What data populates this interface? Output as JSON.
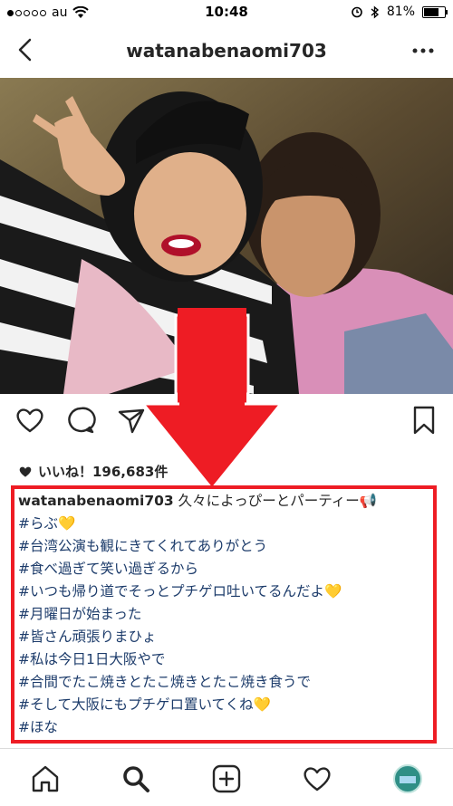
{
  "status_bar": {
    "carrier": "au",
    "time": "10:48",
    "battery": "81%",
    "battery_level": 0.81
  },
  "header": {
    "title": "watanabenaomi703"
  },
  "post": {
    "likes_label": "いいね！196,683件",
    "caption_user": "watanabenaomi703",
    "caption_first": "久々によっぴーとパーティー📢",
    "caption_lines": [
      "#らぶ💛",
      "#台湾公演も観にきてくれてありがとう",
      "#食べ過ぎて笑い過ぎるから",
      "#いつも帰り道でそっとプチゲロ吐いてるんだよ💛",
      "#月曜日が始まった",
      "#皆さん頑張りまひょ",
      "#私は今日1日大阪やで",
      "#合間でたこ焼きとたこ焼きとたこ焼き食うで",
      "#そして大阪にもプチゲロ置いてくね💛",
      "#ほな"
    ]
  },
  "icons": {
    "back": "chevron-left-icon",
    "more": "more-dots-icon",
    "like": "heart-icon",
    "comment": "comment-icon",
    "share": "send-icon",
    "save": "bookmark-icon",
    "home": "home-icon",
    "search": "search-icon",
    "add": "add-icon",
    "activity": "heart-icon",
    "profile": "avatar"
  },
  "colors": {
    "highlight_box": "#ee1c24",
    "hashtag": "#1d3c6b",
    "arrow": "#ee1c24"
  }
}
